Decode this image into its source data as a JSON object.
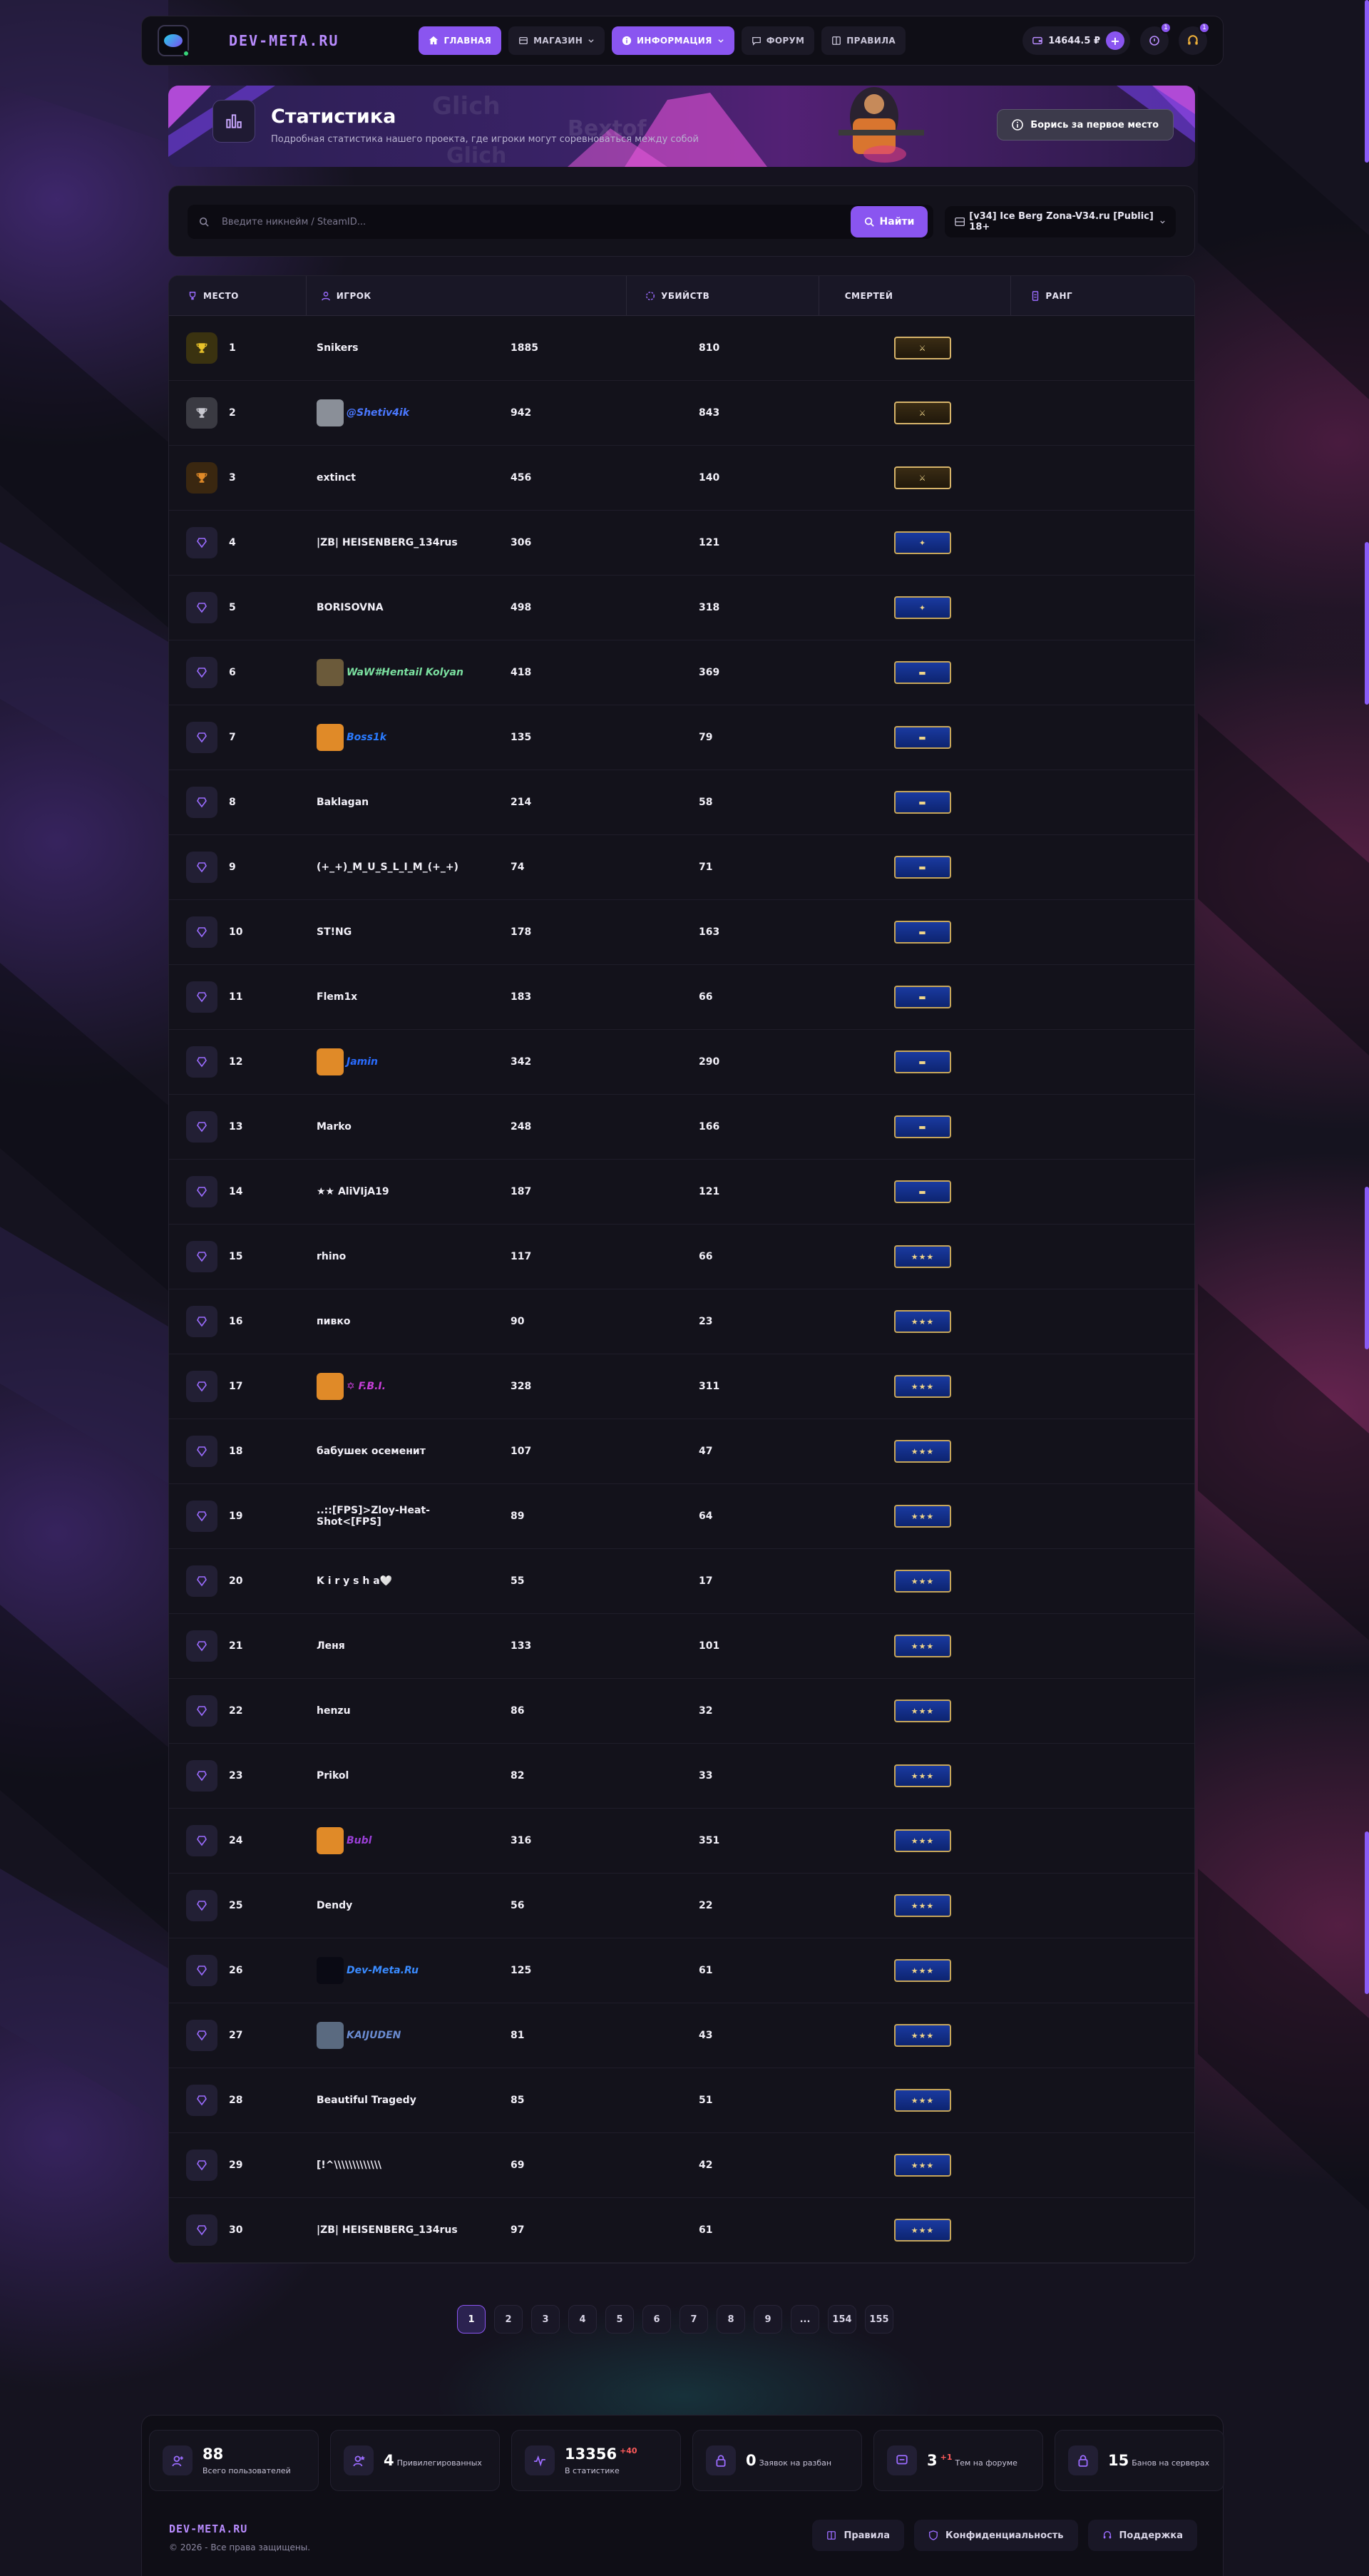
{
  "header": {
    "brand": "DEV-META.RU",
    "nav": [
      {
        "label": "ГЛАВНАЯ",
        "icon": "home-icon",
        "active": true
      },
      {
        "label": "МАГАЗИН",
        "icon": "shop-icon",
        "dropdown": true
      },
      {
        "label": "ИНФОРМАЦИЯ",
        "icon": "info-icon",
        "dropdown": true,
        "active": true
      },
      {
        "label": "ФОРУМ",
        "icon": "forum-icon"
      },
      {
        "label": "ПРАВИЛА",
        "icon": "rules-icon"
      }
    ],
    "balance": "14644.5 ₽",
    "notifications_count": "1",
    "support_count": "1"
  },
  "banner": {
    "title": "Статистика",
    "subtitle": "Подробная статистика нашего проекта, где игроки могут соревноваться между собой",
    "button_label": "Борись за первое место"
  },
  "search": {
    "placeholder": "Введите никнейм / SteamID...",
    "button_label": "Найти",
    "server": "[v34] Ice Berg Zona-V34.ru [Public] 18+"
  },
  "table": {
    "headers": {
      "place": "МЕСТО",
      "player": "ИГРОК",
      "kills": "УБИЙСТВ",
      "deaths": "СМЕРТЕЙ",
      "rank": "РАНГ"
    },
    "rows": [
      {
        "place": "1",
        "player": "Snikers",
        "kills": "1885",
        "deaths": "810"
      },
      {
        "place": "2",
        "player": "@Shetiv4ik",
        "kills": "942",
        "deaths": "843"
      },
      {
        "place": "3",
        "player": "extinct",
        "kills": "456",
        "deaths": "140"
      },
      {
        "place": "4",
        "player": "|ZB| HEISENBERG_134rus",
        "kills": "306",
        "deaths": "121"
      },
      {
        "place": "5",
        "player": "BORISOVNA",
        "kills": "498",
        "deaths": "318"
      },
      {
        "place": "6",
        "player": "WaW#Hentail Kolyan",
        "kills": "418",
        "deaths": "369"
      },
      {
        "place": "7",
        "player": "Boss1k",
        "kills": "135",
        "deaths": "79"
      },
      {
        "place": "8",
        "player": "Baklagan",
        "kills": "214",
        "deaths": "58"
      },
      {
        "place": "9",
        "player": "(+_+)_M_U_S_L_I_M_(+_+)",
        "kills": "74",
        "deaths": "71"
      },
      {
        "place": "10",
        "player": "ST!NG",
        "kills": "178",
        "deaths": "163"
      },
      {
        "place": "11",
        "player": "Flem1x",
        "kills": "183",
        "deaths": "66"
      },
      {
        "place": "12",
        "player": "Jamin",
        "kills": "342",
        "deaths": "290"
      },
      {
        "place": "13",
        "player": "Marko",
        "kills": "248",
        "deaths": "166"
      },
      {
        "place": "14",
        "player": "★★ AliVIjA19",
        "kills": "187",
        "deaths": "121"
      },
      {
        "place": "15",
        "player": "rhino",
        "kills": "117",
        "deaths": "66"
      },
      {
        "place": "16",
        "player": "пивко",
        "kills": "90",
        "deaths": "23"
      },
      {
        "place": "17",
        "player": "✡ F.B.I.",
        "kills": "328",
        "deaths": "311"
      },
      {
        "place": "18",
        "player": "бабушек осеменит",
        "kills": "107",
        "deaths": "47"
      },
      {
        "place": "19",
        "player": "..::[FPS]>Zloy-Heat-Shot<[FPS]",
        "kills": "89",
        "deaths": "64"
      },
      {
        "place": "20",
        "player": "K i r y s h a🤍",
        "kills": "55",
        "deaths": "17"
      },
      {
        "place": "21",
        "player": "Леня",
        "kills": "133",
        "deaths": "101"
      },
      {
        "place": "22",
        "player": "henzu",
        "kills": "86",
        "deaths": "32"
      },
      {
        "place": "23",
        "player": "Prikol",
        "kills": "82",
        "deaths": "33"
      },
      {
        "place": "24",
        "player": "Bubl",
        "kills": "316",
        "deaths": "351"
      },
      {
        "place": "25",
        "player": "Dendy",
        "kills": "56",
        "deaths": "22"
      },
      {
        "place": "26",
        "player": "Dev-Meta.Ru",
        "kills": "125",
        "deaths": "61"
      },
      {
        "place": "27",
        "player": "KAIJUDEN",
        "kills": "81",
        "deaths": "43"
      },
      {
        "place": "28",
        "player": "Beautiful Tragedy",
        "kills": "85",
        "deaths": "51"
      },
      {
        "place": "29",
        "player": "[!^\\\\\\\\\\\\\\\\\\\\\\\\\\",
        "kills": "69",
        "deaths": "42"
      },
      {
        "place": "30",
        "player": "|ZB| HEISENBERG_134rus",
        "kills": "97",
        "deaths": "61"
      }
    ]
  },
  "pagination": [
    "1",
    "2",
    "3",
    "4",
    "5",
    "6",
    "7",
    "8",
    "9",
    "...",
    "154",
    "155"
  ],
  "footer": {
    "stats": [
      {
        "num": "88",
        "label": "Всего пользователей",
        "icon": "user-add-icon"
      },
      {
        "num": "4",
        "label": "Привилегированных",
        "icon": "user-star-icon"
      },
      {
        "num": "13356",
        "delta": "+40",
        "label": "В статистике",
        "icon": "activity-icon"
      },
      {
        "num": "0",
        "label": "Заявок на разбан",
        "icon": "lock-icon"
      },
      {
        "num": "3",
        "delta": "+1",
        "label": "Тем на форуме",
        "icon": "chat-icon"
      },
      {
        "num": "15",
        "label": "Банов на серверах",
        "icon": "lock-icon"
      }
    ],
    "brand": "DEV-META.RU",
    "copyright": "© 2026 - Все права защищены.",
    "links": [
      "Правила",
      "Конфиденциальность",
      "Поддержка"
    ]
  },
  "colors": {
    "accent": "#8a55f0",
    "brand": "#b98cff",
    "background": "#15131f",
    "card": "#13121b"
  }
}
